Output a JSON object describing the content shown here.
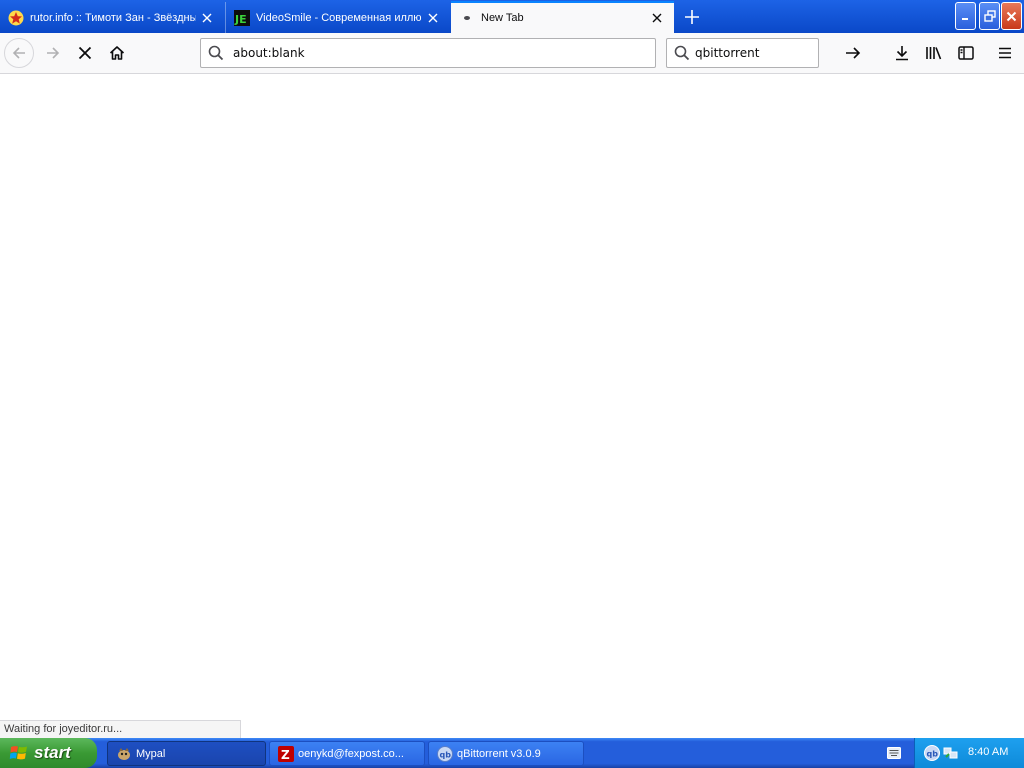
{
  "browser": {
    "tabs": [
      {
        "title": "rutor.info :: Тимоти Зан - Звёздные",
        "favicon": "rutor-star-icon",
        "active": false
      },
      {
        "title": "VideoSmile - Современная иллюстрация",
        "favicon": "joyeditor-je-icon",
        "active": false
      },
      {
        "title": "New Tab",
        "favicon": "loading-dot-icon",
        "active": true
      }
    ],
    "url": "about:blank",
    "search_query": "qbittorrent",
    "status_text": "Waiting for joyeditor.ru..."
  },
  "taskbar": {
    "start_label": "start",
    "items": [
      {
        "label": "Mypal",
        "icon": "mypal-icon",
        "active": true
      },
      {
        "label": "oenykd@fexpost.co...",
        "icon": "filezilla-icon",
        "active": false
      },
      {
        "label": "qBittorrent v3.0.9",
        "icon": "qbittorrent-icon",
        "active": false
      }
    ],
    "clock": "8:40 AM"
  },
  "colors": {
    "accent": "#0a84ff",
    "xp_blue": "#245edb",
    "start_green": "#3a9a34"
  }
}
